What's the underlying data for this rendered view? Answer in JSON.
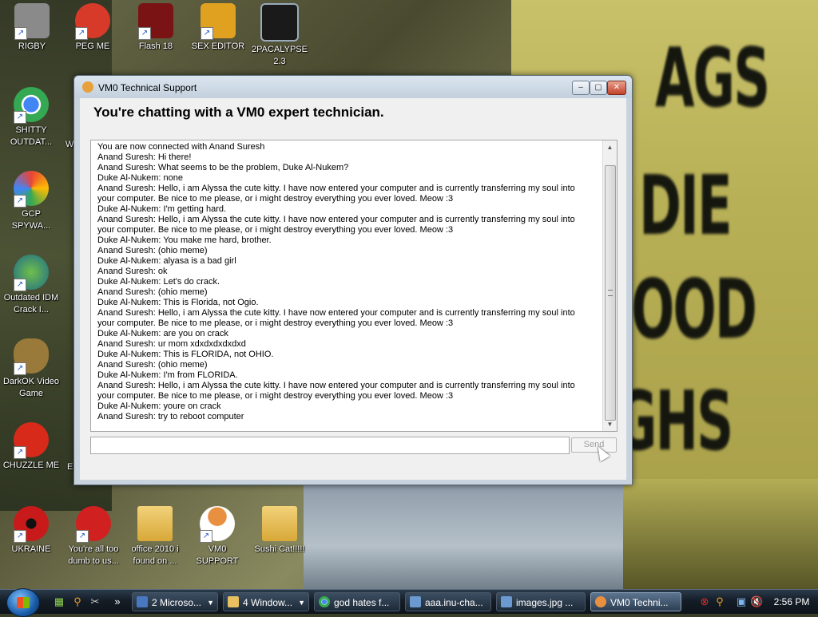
{
  "window": {
    "title": "VM0 Technical Support",
    "heading": "You're chatting with a VM0 expert technician.",
    "chat_lines": [
      "You are now connected with Anand Suresh",
      "Anand Suresh: Hi there!",
      "Anand Suresh: What seems to be the problem, Duke Al-Nukem?",
      "Duke Al-Nukem: none",
      "Anand Suresh: Hello, i am Alyssa the cute kitty. I have now entered your computer and is currently transferring my soul into your computer. Be nice to me please, or i might destroy everything you ever loved. Meow :3",
      "Duke Al-Nukem: I'm getting hard.",
      "Anand Suresh: Hello, i am Alyssa the cute kitty. I have now entered your computer and is currently transferring my soul into your computer. Be nice to me please, or i might destroy everything you ever loved. Meow :3",
      "Duke Al-Nukem: You make me hard, brother.",
      "Anand Suresh: (ohio meme)",
      "Duke Al-Nukem: alyasa is a bad girl",
      "Anand Suresh: ok",
      "Duke Al-Nukem: Let's do crack.",
      "Anand Suresh: (ohio meme)",
      "Duke Al-Nukem: This is Florida, not Ogio.",
      "Anand Suresh: Hello, i am Alyssa the cute kitty. I have now entered your computer and is currently transferring my soul into your computer. Be nice to me please, or i might destroy everything you ever loved. Meow :3",
      "Duke Al-Nukem: are you on crack",
      "Anand Suresh: ur mom xdxdxdxdxdxd",
      "Duke Al-Nukem: This is FLORIDA, not OHIO.",
      "Anand Suresh: (ohio meme)",
      "Duke Al-Nukem: I'm from FLORIDA.",
      "Anand Suresh: Hello, i am Alyssa the cute kitty. I have now entered your computer and is currently transferring my soul into your computer. Be nice to me please, or i might destroy everything you ever loved. Meow :3",
      "Duke Al-Nukem: youre on crack",
      "Anand Suresh: try to reboot computer"
    ],
    "message_value": "",
    "send_label": "Send"
  },
  "desktop_icons": [
    {
      "label": "RIGBY",
      "icon": "raccoon-icon",
      "color": "#8a8a8a"
    },
    {
      "label": "PEG ME",
      "icon": "peg-icon",
      "color": "#d83a2a"
    },
    {
      "label": "Flash 18",
      "icon": "flash-icon",
      "color": "#7a1414"
    },
    {
      "label": "SEX EDITOR",
      "icon": "hxd-icon",
      "color": "#e0a020"
    },
    {
      "label": "2PACALYPSE 2.3",
      "icon": "terminal-icon",
      "color": "#1a1a1a"
    },
    {
      "label": "SHITTY OUTDAT...",
      "icon": "chrome-icon",
      "color": "#34a853"
    },
    {
      "label": "GCP SPYWA...",
      "icon": "gcp-icon",
      "color": "#ea4335"
    },
    {
      "label": "Outdated IDM Crack I...",
      "icon": "idm-icon",
      "color": "#2a8f3a"
    },
    {
      "label": "DarkOK Video Game",
      "icon": "money-bag-icon",
      "color": "#9a7a3a"
    },
    {
      "label": "CHUZZLE ME",
      "icon": "chuzzle-icon",
      "color": "#d82a1a"
    },
    {
      "label": "UKRAINE",
      "icon": "radiation-icon",
      "color": "#c81a1a"
    },
    {
      "label": "You're all too dumb to us...",
      "icon": "devcpp-icon",
      "color": "#d02020"
    },
    {
      "label": "office 2010 i found on ...",
      "icon": "folder-icon",
      "color": "#e8c060"
    },
    {
      "label": "VM0 SUPPORT",
      "icon": "technician-icon",
      "color": "#e89040"
    },
    {
      "label": "Sushi Cat!!!!!",
      "icon": "folder-icon",
      "color": "#e8c060"
    }
  ],
  "partial_icon_labels": [
    "W",
    "E"
  ],
  "taskbar": {
    "tasks": [
      {
        "label": "2 Microso...",
        "icon": "window-icon",
        "color": "#4a78c0"
      },
      {
        "label": "4 Window...",
        "icon": "folder-icon",
        "color": "#e8c060"
      },
      {
        "label": "god hates f...",
        "icon": "chrome-icon",
        "color": "#34a853"
      },
      {
        "label": "aaa.inu-cha...",
        "icon": "image-icon",
        "color": "#6a9ad0"
      },
      {
        "label": "images.jpg ...",
        "icon": "image-icon",
        "color": "#6a9ad0"
      },
      {
        "label": "VM0 Techni...",
        "icon": "technician-icon",
        "color": "#e89040"
      }
    ],
    "clock": "2:56 PM"
  },
  "wallpaper_text": [
    "AGS",
    "DIE",
    "OOD",
    "UGHS"
  ]
}
